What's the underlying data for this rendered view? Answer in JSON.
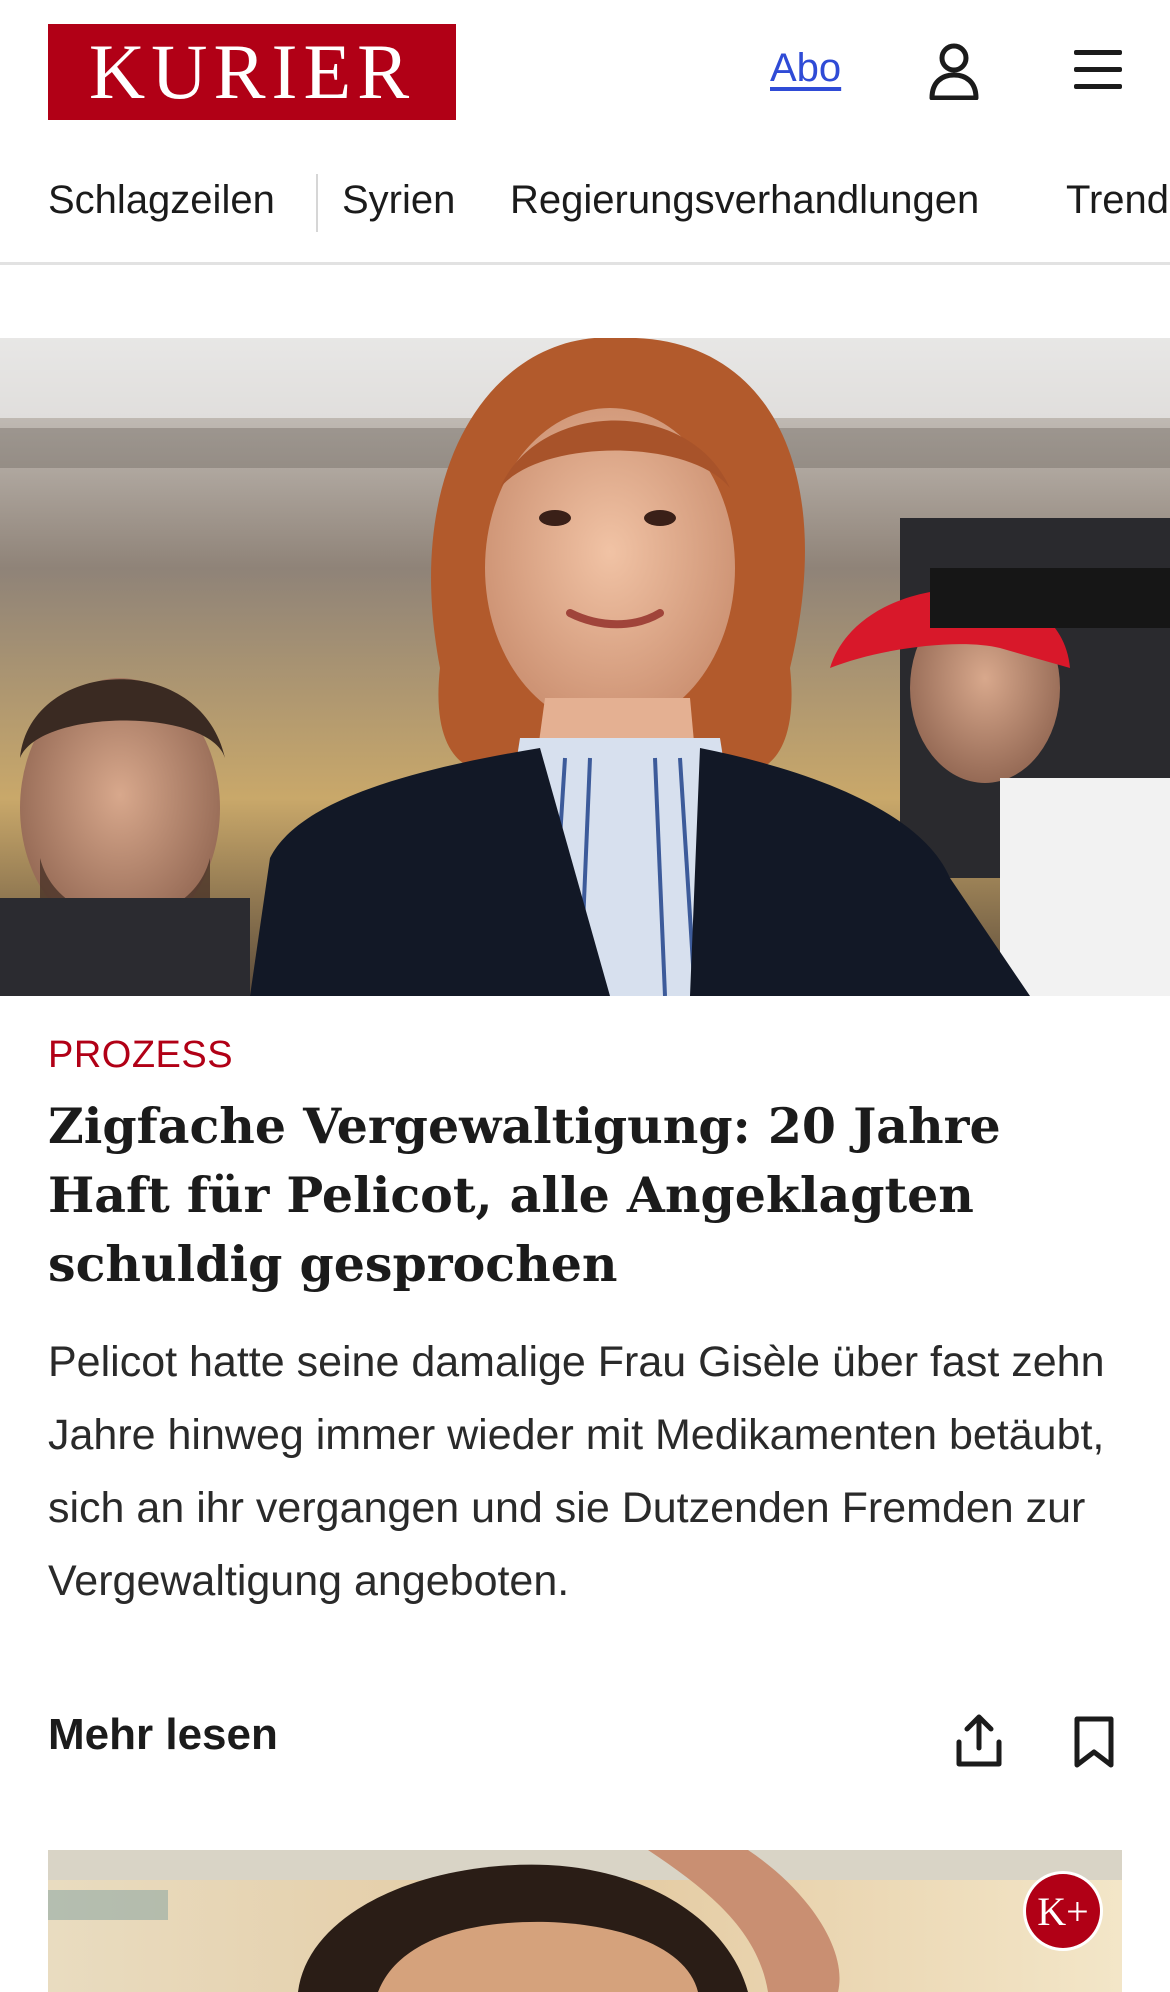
{
  "header": {
    "logo_text": "KURIER",
    "abo_label": "Abo",
    "user_icon": "user-icon",
    "menu_icon": "hamburger-menu-icon"
  },
  "nav": {
    "items": [
      {
        "label": "Schlagzeilen"
      },
      {
        "label": "Syrien"
      },
      {
        "label": "Regierungsverhandlungen"
      },
      {
        "label": "Trend"
      }
    ]
  },
  "article": {
    "kicker": "PROZESS",
    "headline": "Zigfache Vergewaltigung: 20 Jahre Haft für Pelicot, alle Angeklagten schuldig gesprochen",
    "teaser": "Pelicot hatte seine damalige Frau Gisèle über fast zehn Jahre hinweg immer wieder mit Medikamenten betäubt, sich an ihr vergangen und sie Dutzenden Fremden zur Vergewaltigung angeboten.",
    "more_label": "Mehr lesen",
    "share_icon": "share-icon",
    "bookmark_icon": "bookmark-icon"
  },
  "next_card": {
    "badge": "K+"
  },
  "colors": {
    "brand": "#b10016",
    "link": "#2f4bd6"
  }
}
